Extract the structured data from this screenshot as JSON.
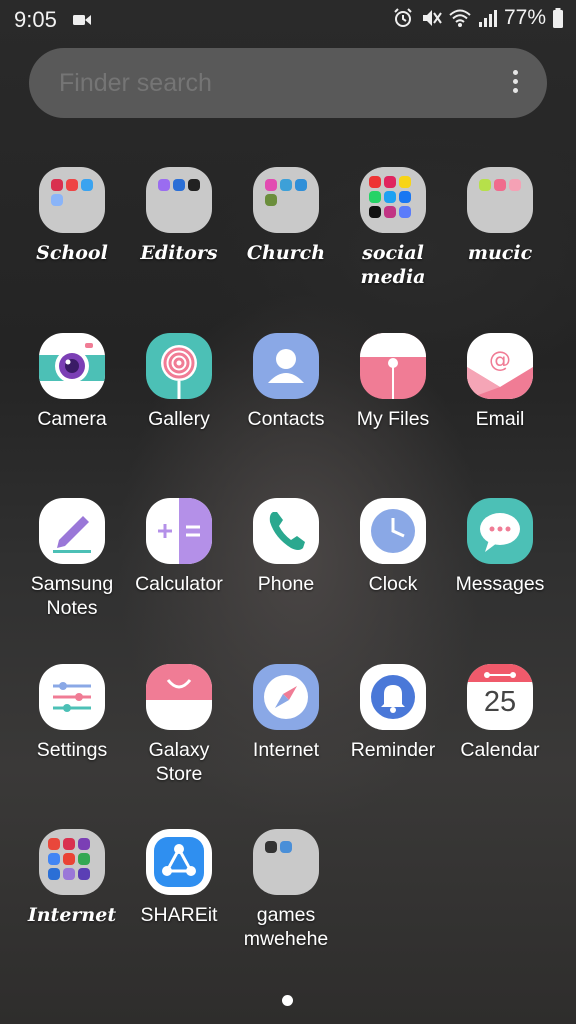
{
  "status": {
    "time": "9:05",
    "battery": "77%"
  },
  "search": {
    "placeholder": "Finder search"
  },
  "apps": [
    {
      "label": "School",
      "folder": true
    },
    {
      "label": "Editors",
      "folder": true
    },
    {
      "label": "Church",
      "folder": true
    },
    {
      "label": "social media",
      "folder": true
    },
    {
      "label": "mucic",
      "folder": true
    },
    {
      "label": "Camera"
    },
    {
      "label": "Gallery"
    },
    {
      "label": "Contacts"
    },
    {
      "label": "My Files"
    },
    {
      "label": "Email"
    },
    {
      "label": "Samsung Notes"
    },
    {
      "label": "Calculator"
    },
    {
      "label": "Phone"
    },
    {
      "label": "Clock"
    },
    {
      "label": "Messages"
    },
    {
      "label": "Settings"
    },
    {
      "label": "Galaxy Store"
    },
    {
      "label": "Internet"
    },
    {
      "label": "Reminder"
    },
    {
      "label": "Calendar",
      "date": "25"
    },
    {
      "label": "Internet",
      "folder": true
    },
    {
      "label": "SHAREit"
    },
    {
      "label": "games mwehehe",
      "folder": true
    }
  ],
  "colors": {
    "accent_blue": "#4a78d8",
    "pink": "#f07c95",
    "teal": "#4cc0b6",
    "purple": "#9a77d8"
  }
}
